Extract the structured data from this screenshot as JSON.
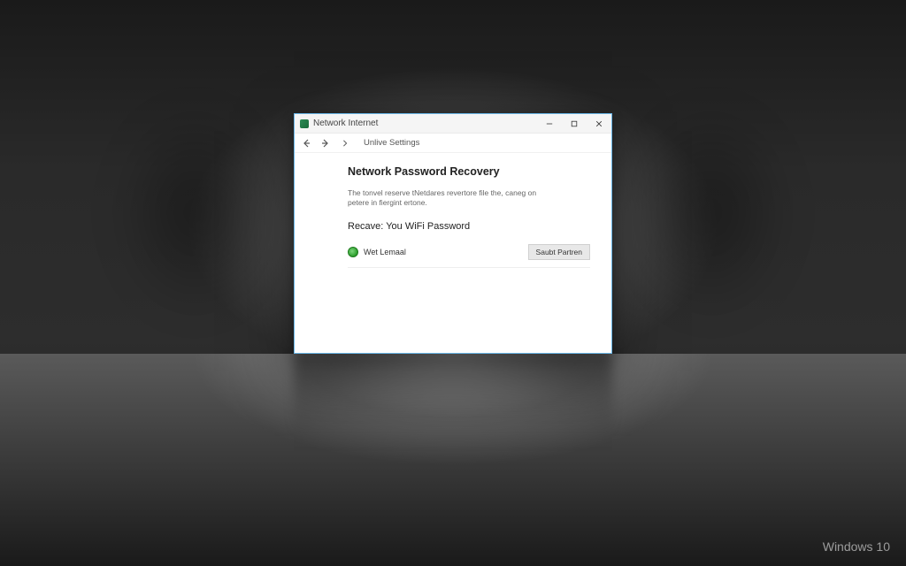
{
  "desktop": {
    "watermark": "Windows 10"
  },
  "window": {
    "title": "Network Internet",
    "nav": {
      "breadcrumb": "Unlive Settings"
    },
    "content": {
      "heading": "Network Password Recovery",
      "description": "The tonvel reserve tNetdares revertore file the, caneg on petere in fiergint ertone.",
      "subheading": "Recave: You WiFi Password",
      "row": {
        "label": "Wet Lemaal",
        "button": "Saubt Partren"
      }
    }
  }
}
